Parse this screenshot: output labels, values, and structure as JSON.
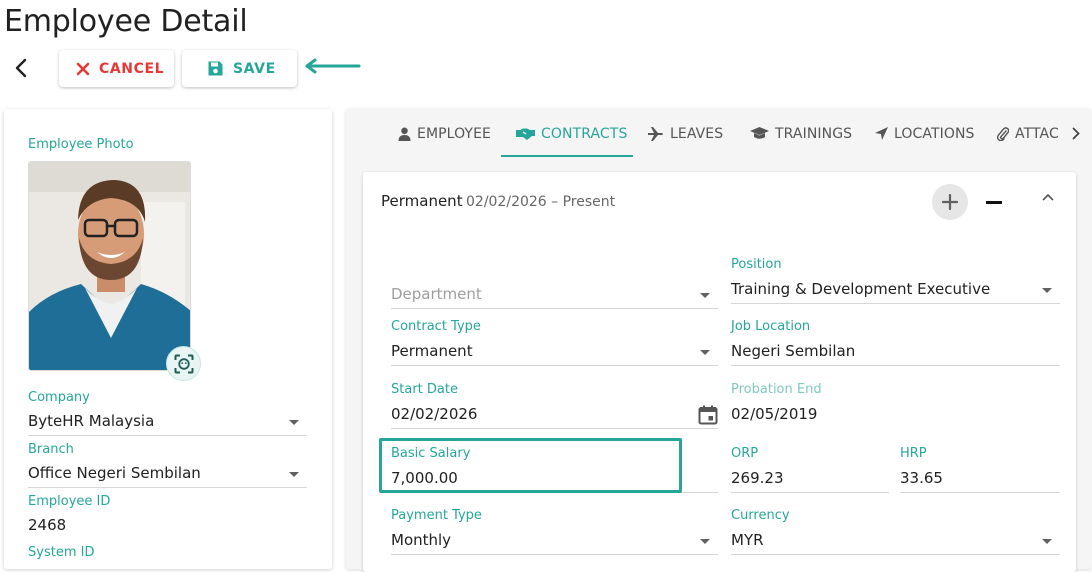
{
  "page": {
    "title": "Employee Detail"
  },
  "toolbar": {
    "cancel_label": "CANCEL",
    "save_label": "SAVE"
  },
  "colors": {
    "accent": "#26a69a",
    "danger": "#e53935"
  },
  "left": {
    "photo_label": "Employee Photo",
    "company": {
      "label": "Company",
      "value": "ByteHR Malaysia"
    },
    "branch": {
      "label": "Branch",
      "value": "Office Negeri Sembilan"
    },
    "employee_id": {
      "label": "Employee ID",
      "value": "2468"
    },
    "system_id": {
      "label": "System ID"
    }
  },
  "tabs": [
    {
      "label": "EMPLOYEE",
      "icon": "person-icon"
    },
    {
      "label": "CONTRACTS",
      "icon": "handshake-icon"
    },
    {
      "label": "LEAVES",
      "icon": "plane-icon"
    },
    {
      "label": "TRAININGS",
      "icon": "graduation-cap-icon"
    },
    {
      "label": "LOCATIONS",
      "icon": "location-arrow-icon"
    },
    {
      "label": "ATTACI",
      "icon": "paperclip-icon"
    }
  ],
  "contract": {
    "type_title": "Permanent",
    "period": "02/02/2026 – Present",
    "department": {
      "placeholder": "Department"
    },
    "position": {
      "label": "Position",
      "value": "Training & Development Executive"
    },
    "contract_type": {
      "label": "Contract Type",
      "value": "Permanent"
    },
    "job_location": {
      "label": "Job Location",
      "value": "Negeri Sembilan"
    },
    "start_date": {
      "label": "Start Date",
      "value": "02/02/2026"
    },
    "probation_end": {
      "label": "Probation End",
      "value": "02/05/2019"
    },
    "basic_salary": {
      "label": "Basic Salary",
      "value": "7,000.00"
    },
    "orp": {
      "label": "ORP",
      "value": "269.23"
    },
    "hrp": {
      "label": "HRP",
      "value": "33.65"
    },
    "payment_type": {
      "label": "Payment Type",
      "value": "Monthly"
    },
    "currency": {
      "label": "Currency",
      "value": "MYR"
    }
  }
}
